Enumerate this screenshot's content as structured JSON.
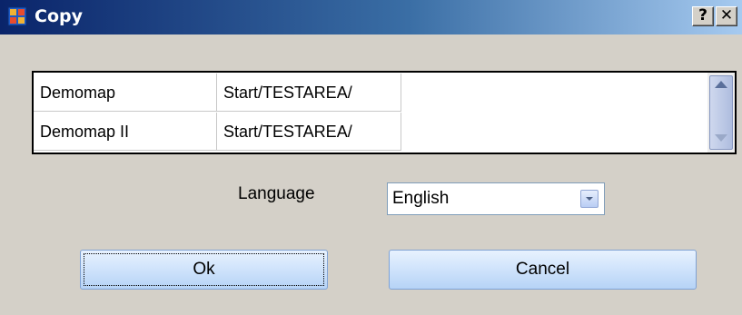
{
  "window": {
    "title": "Copy",
    "help_glyph": "?",
    "close_glyph": "✕"
  },
  "grid": {
    "rows": [
      {
        "name": "Demomap",
        "path": "Start/TESTAREA/"
      },
      {
        "name": "Demomap II",
        "path": "Start/TESTAREA/"
      }
    ]
  },
  "language": {
    "label": "Language",
    "selected": "English"
  },
  "buttons": {
    "ok": "Ok",
    "cancel": "Cancel"
  },
  "icons": {
    "app": "app-window-icon",
    "scroll_up": "arrow-up-icon",
    "scroll_down": "arrow-down-icon",
    "dropdown": "chevron-down-icon"
  },
  "colors": {
    "title_gradient_start": "#0a246a",
    "title_gradient_end": "#a6caf0",
    "dialog_bg": "#d4d0c8",
    "button_bg": "#cfe3fb"
  }
}
